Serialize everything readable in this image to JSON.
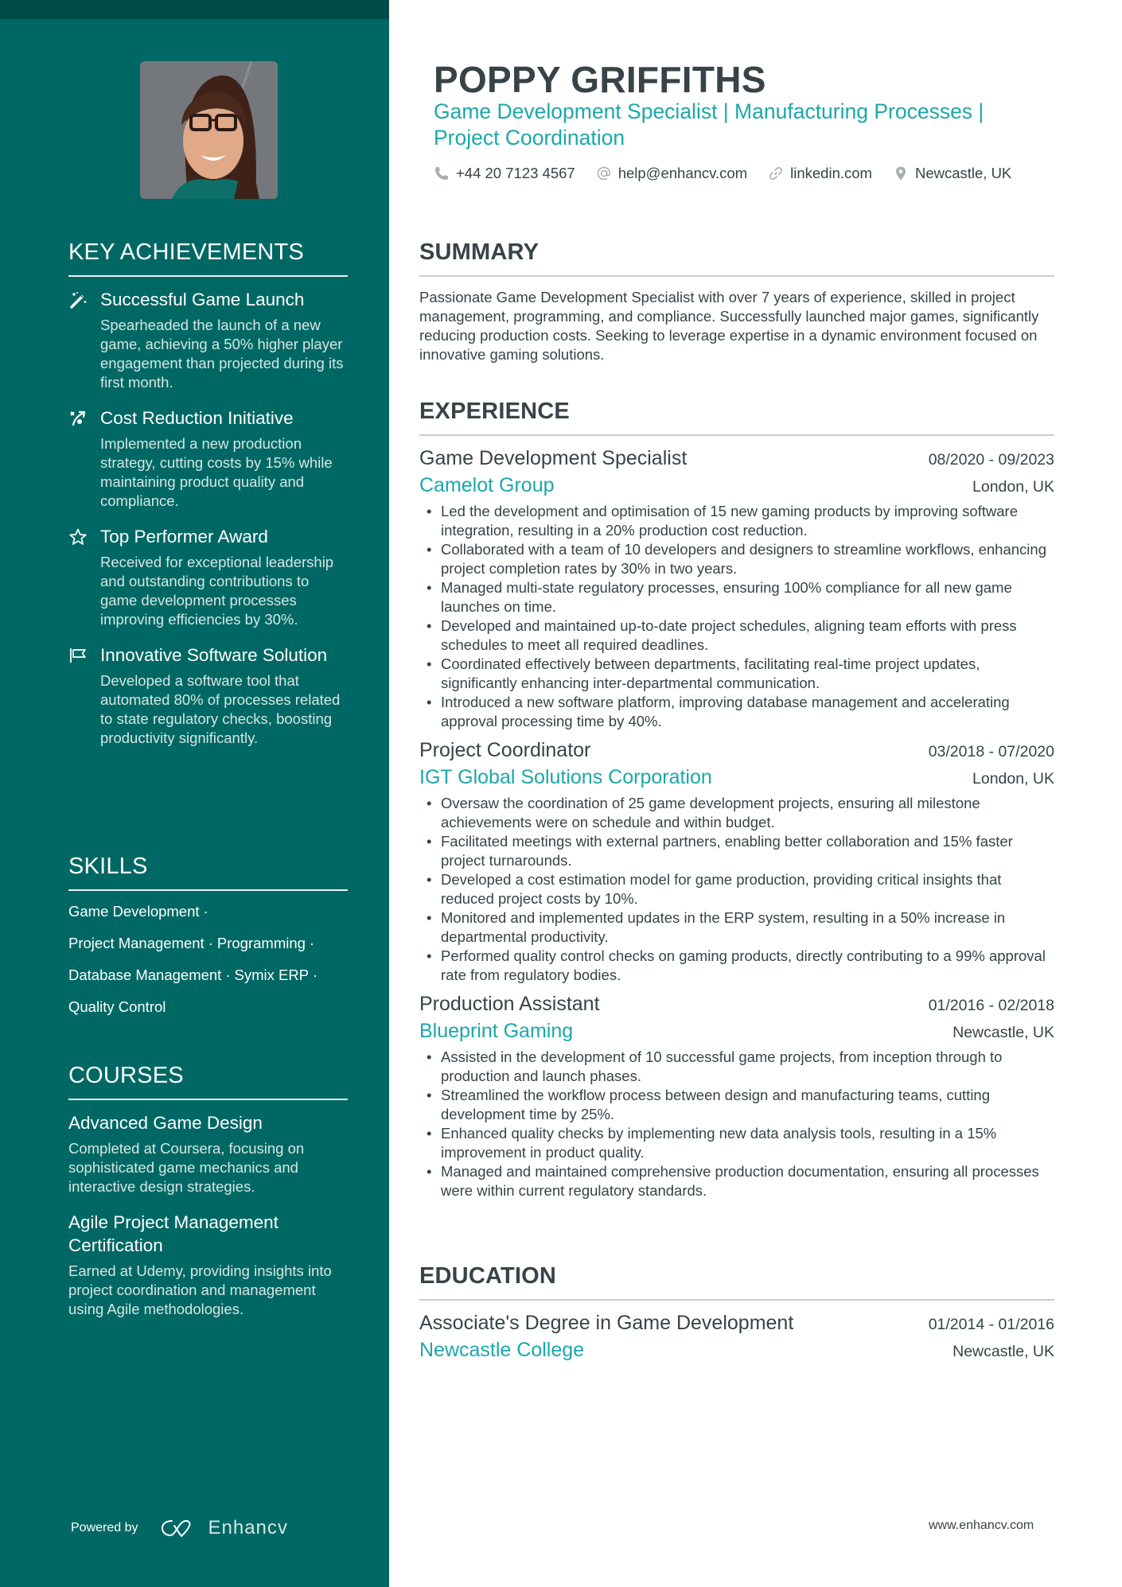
{
  "header": {
    "name": "POPPY GRIFFITHS",
    "tagline": "Game Development Specialist | Manufacturing Processes | Project Coordination",
    "contact": {
      "phone": "+44 20 7123 4567",
      "email": "help@enhancv.com",
      "link": "linkedin.com",
      "location": "Newcastle, UK"
    }
  },
  "sidebar": {
    "photo_alt": "Profile photo",
    "achievements": {
      "heading": "KEY ACHIEVEMENTS",
      "items": [
        {
          "icon": "magic-wand-icon",
          "title": "Successful Game Launch",
          "description": "Spearheaded the launch of a new game, achieving a 50% higher player engagement than projected during its first month."
        },
        {
          "icon": "strategy-arrow-icon",
          "title": "Cost Reduction Initiative",
          "description": "Implemented a new production strategy, cutting costs by 15% while maintaining product quality and compliance."
        },
        {
          "icon": "star-icon",
          "title": "Top Performer Award",
          "description": "Received for exceptional leadership and outstanding contributions to game development processes improving efficiencies by 30%."
        },
        {
          "icon": "flag-icon",
          "title": "Innovative Software Solution",
          "description": "Developed a software tool that automated 80% of processes related to state regulatory checks, boosting productivity significantly."
        }
      ]
    },
    "skills": {
      "heading": "SKILLS",
      "lines": [
        [
          "Game Development"
        ],
        [
          "Project Management",
          "Programming"
        ],
        [
          "Database Management",
          "Symix ERP"
        ],
        [
          "Quality Control"
        ]
      ],
      "separator": "·"
    },
    "courses": {
      "heading": "COURSES",
      "items": [
        {
          "title": "Advanced Game Design",
          "description": "Completed at Coursera, focusing on sophisticated game mechanics and interactive design strategies."
        },
        {
          "title": "Agile Project Management Certification",
          "description": "Earned at Udemy, providing insights into project coordination and management using Agile methodologies."
        }
      ]
    },
    "footer": {
      "powered_by": "Powered by",
      "brand": "Enhancv"
    }
  },
  "main": {
    "summary": {
      "heading": "SUMMARY",
      "text": "Passionate Game Development Specialist with over 7 years of experience, skilled in project management, programming, and compliance. Successfully launched major games, significantly reducing production costs. Seeking to leverage expertise in a dynamic environment focused on innovative gaming solutions."
    },
    "experience": {
      "heading": "EXPERIENCE",
      "jobs": [
        {
          "title": "Game Development Specialist",
          "dates": "08/2020 - 09/2023",
          "company": "Camelot Group",
          "location": "London, UK",
          "bullets": [
            "Led the development and optimisation of 15 new gaming products by improving software integration, resulting in a 20% production cost reduction.",
            "Collaborated with a team of 10 developers and designers to streamline workflows, enhancing project completion rates by 30% in two years.",
            "Managed multi-state regulatory processes, ensuring 100% compliance for all new game launches on time.",
            "Developed and maintained up-to-date project schedules, aligning team efforts with press schedules to meet all required deadlines.",
            "Coordinated effectively between departments, facilitating real-time project updates, significantly enhancing inter-departmental communication.",
            "Introduced a new software platform, improving database management and accelerating approval processing time by 40%."
          ]
        },
        {
          "title": "Project Coordinator",
          "dates": "03/2018 - 07/2020",
          "company": "IGT Global Solutions Corporation",
          "location": "London, UK",
          "bullets": [
            "Oversaw the coordination of 25 game development projects, ensuring all milestone achievements were on schedule and within budget.",
            "Facilitated meetings with external partners, enabling better collaboration and 15% faster project turnarounds.",
            "Developed a cost estimation model for game production, providing critical insights that reduced project costs by 10%.",
            "Monitored and implemented updates in the ERP system, resulting in a 50% increase in departmental productivity.",
            "Performed quality control checks on gaming products, directly contributing to a 99% approval rate from regulatory bodies."
          ]
        },
        {
          "title": "Production Assistant",
          "dates": "01/2016 - 02/2018",
          "company": "Blueprint Gaming",
          "location": "Newcastle, UK",
          "bullets": [
            "Assisted in the development of 10 successful game projects, from inception through to production and launch phases.",
            "Streamlined the workflow process between design and manufacturing teams, cutting development time by 25%.",
            "Enhanced quality checks by implementing new data analysis tools, resulting in a 15% improvement in product quality.",
            "Managed and maintained comprehensive production documentation, ensuring all processes were within current regulatory standards."
          ]
        }
      ]
    },
    "education": {
      "heading": "EDUCATION",
      "items": [
        {
          "degree": "Associate's Degree in Game Development",
          "dates": "01/2014 - 01/2016",
          "school": "Newcastle College",
          "location": "Newcastle, UK"
        }
      ]
    },
    "footer_url": "www.enhancv.com"
  },
  "colors": {
    "sidebar_bg": "#006864",
    "sidebar_topband": "#004a47",
    "accent": "#1ba8aa",
    "text_dark": "#384347"
  }
}
